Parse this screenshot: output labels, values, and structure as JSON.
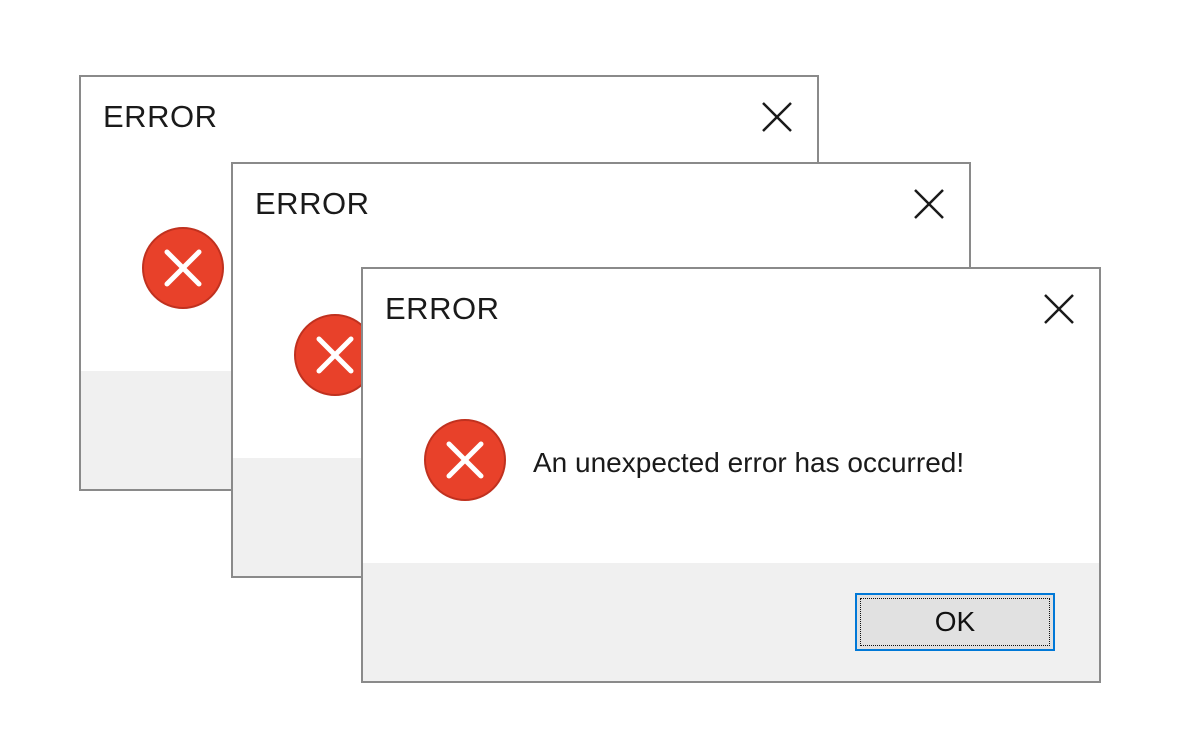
{
  "dialogs": [
    {
      "title": "ERROR",
      "close_icon": "close-icon",
      "status_icon": "error-icon"
    },
    {
      "title": "ERROR",
      "close_icon": "close-icon",
      "status_icon": "error-icon"
    },
    {
      "title": "ERROR",
      "close_icon": "close-icon",
      "status_icon": "error-icon",
      "message": "An unexpected error has occurred!",
      "ok_label": "OK"
    }
  ],
  "colors": {
    "error_red": "#e8412a",
    "error_red_border": "#c0311f",
    "focus_blue": "#0078d7",
    "footer_gray": "#f0f0f0"
  }
}
